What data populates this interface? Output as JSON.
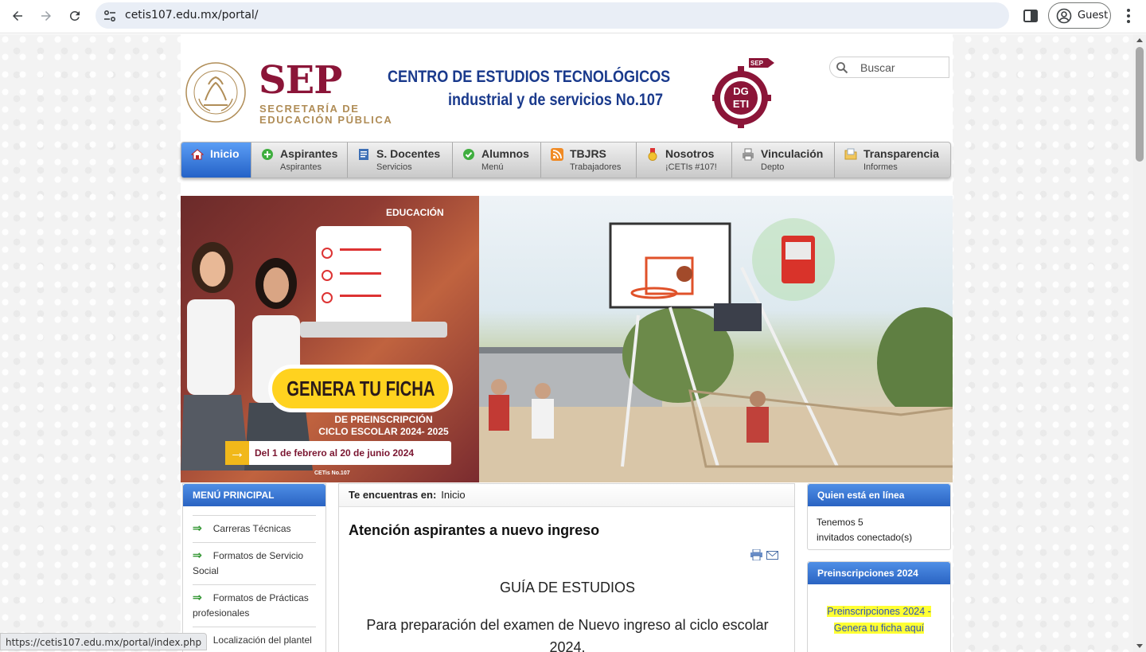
{
  "browser": {
    "url": "cetis107.edu.mx/portal/",
    "profile_label": "Guest",
    "status_url": "https://cetis107.edu.mx/portal/index.php"
  },
  "header": {
    "sep_word": "SEP",
    "sep_line1": "SECRETARÍA DE",
    "sep_line2": "EDUCACIÓN PÚBLICA",
    "center_line1": "CENTRO DE ESTUDIOS TECNOLÓGICOS",
    "center_line2": "industrial y de servicios No.107",
    "search_placeholder": "Buscar"
  },
  "menu": [
    {
      "label": "Inicio",
      "sub": "",
      "icon": "home-icon",
      "active": true
    },
    {
      "label": "Aspirantes",
      "sub": "Aspirantes",
      "icon": "plus-circle-icon"
    },
    {
      "label": "S. Docentes",
      "sub": "Servicios",
      "icon": "document-icon"
    },
    {
      "label": "Alumnos",
      "sub": "Menú",
      "icon": "check-circle-icon"
    },
    {
      "label": "TBJRS",
      "sub": "Trabajadores",
      "icon": "rss-icon"
    },
    {
      "label": "Nosotros",
      "sub": "¡CETIs #107!",
      "icon": "medal-icon"
    },
    {
      "label": "Vinculación",
      "sub": "Depto",
      "icon": "printer-icon"
    },
    {
      "label": "Transparencia",
      "sub": "Informes",
      "icon": "folder-icon"
    }
  ],
  "banner": {
    "educacion": "EDUCACIÓN",
    "ficha": "GENERA TU FICHA",
    "preins_line1": "DE PREINSCRIPCIÓN",
    "preins_line2": "CICLO ESCOLAR 2024- 2025",
    "dates": "Del 1 de febrero al 20 de junio 2024",
    "handle": "CETis No.107"
  },
  "left_menu": {
    "title": "MENÚ PRINCIPAL",
    "items": [
      "Carreras Técnicas",
      "Formatos de Servicio Social",
      "Formatos de Prácticas profesionales",
      "Localización del plantel"
    ]
  },
  "content": {
    "breadcrumb_label": "Te encuentras en:",
    "breadcrumb_value": "Inicio",
    "title": "Atención aspirantes a nuevo ingreso",
    "guide_heading": "GUÍA DE ESTUDIOS",
    "paragraph": "Para preparación del examen de Nuevo ingreso al ciclo escolar 2024."
  },
  "right": {
    "online_title": "Quien está en línea",
    "online_line1": "Tenemos 5",
    "online_line2": "invitados conectado(s)",
    "preins_title": "Preinscripciones 2024",
    "preins_link1": "Preinscripciones 2024 -",
    "preins_link2": "Genera tu ficha aquí"
  }
}
